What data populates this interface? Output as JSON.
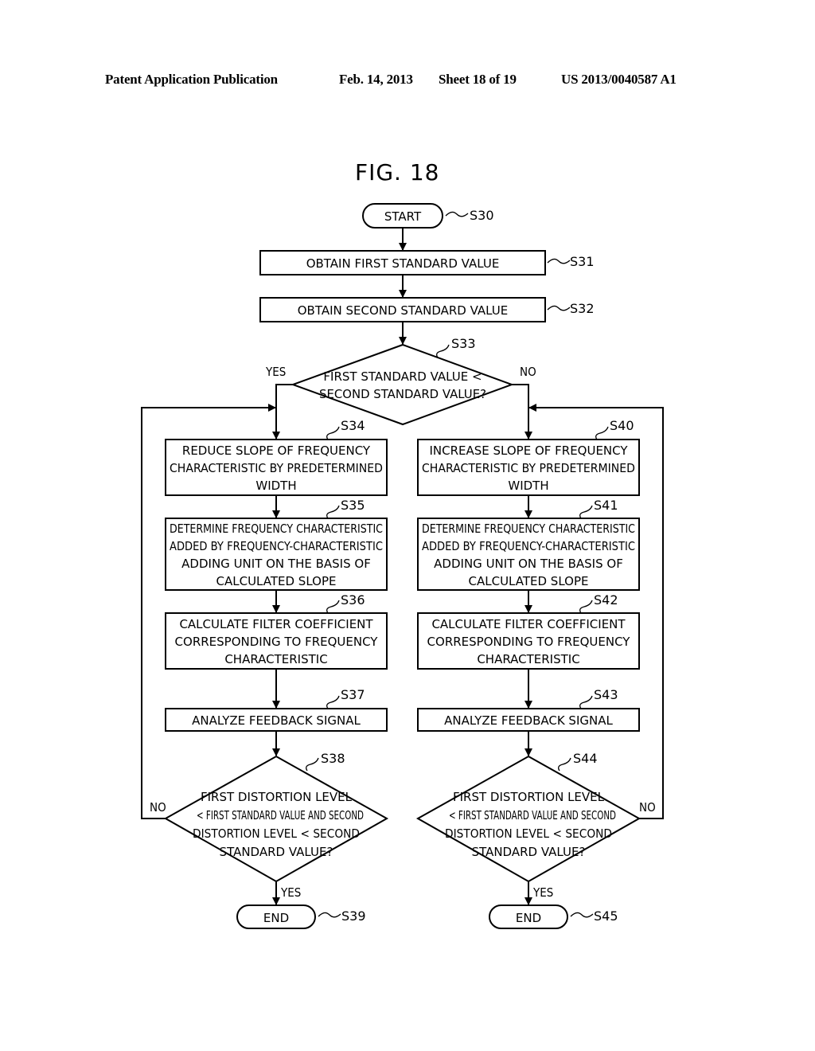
{
  "header": {
    "publication": "Patent Application Publication",
    "date": "Feb. 14, 2013",
    "sheet": "Sheet 18 of 19",
    "number": "US 2013/0040587 A1"
  },
  "figure": {
    "title": "FIG. 18"
  },
  "flowchart": {
    "start": {
      "id": "S30",
      "text": "START"
    },
    "s31": {
      "id": "S31",
      "lines": [
        "OBTAIN FIRST STANDARD VALUE"
      ]
    },
    "s32": {
      "id": "S32",
      "lines": [
        "OBTAIN SECOND STANDARD VALUE"
      ]
    },
    "s33": {
      "id": "S33",
      "lines": [
        "FIRST STANDARD VALUE <",
        "SECOND STANDARD VALUE?"
      ],
      "yes": "YES",
      "no": "NO"
    },
    "left": {
      "s34": {
        "id": "S34",
        "lines": [
          "REDUCE SLOPE OF FREQUENCY",
          "CHARACTERISTIC BY PREDETERMINED",
          "WIDTH"
        ]
      },
      "s35": {
        "id": "S35",
        "lines": [
          "DETERMINE FREQUENCY CHARACTERISTIC",
          "ADDED BY FREQUENCY-CHARACTERISTIC",
          "ADDING UNIT ON THE BASIS OF",
          "CALCULATED SLOPE"
        ]
      },
      "s36": {
        "id": "S36",
        "lines": [
          "CALCULATE FILTER COEFFICIENT",
          "CORRESPONDING TO FREQUENCY",
          "CHARACTERISTIC"
        ]
      },
      "s37": {
        "id": "S37",
        "lines": [
          "ANALYZE FEEDBACK SIGNAL"
        ]
      },
      "s38": {
        "id": "S38",
        "lines": [
          "FIRST DISTORTION LEVEL",
          "< FIRST STANDARD VALUE AND SECOND",
          "DISTORTION LEVEL < SECOND",
          "STANDARD VALUE?"
        ],
        "yes": "YES",
        "no": "NO"
      },
      "end": {
        "id": "S39",
        "text": "END"
      }
    },
    "right": {
      "s40": {
        "id": "S40",
        "lines": [
          "INCREASE SLOPE OF FREQUENCY",
          "CHARACTERISTIC BY PREDETERMINED",
          "WIDTH"
        ]
      },
      "s41": {
        "id": "S41",
        "lines": [
          "DETERMINE FREQUENCY CHARACTERISTIC",
          "ADDED BY FREQUENCY-CHARACTERISTIC",
          "ADDING UNIT ON THE BASIS OF",
          "CALCULATED SLOPE"
        ]
      },
      "s42": {
        "id": "S42",
        "lines": [
          "CALCULATE FILTER COEFFICIENT",
          "CORRESPONDING TO FREQUENCY",
          "CHARACTERISTIC"
        ]
      },
      "s43": {
        "id": "S43",
        "lines": [
          "ANALYZE FEEDBACK SIGNAL"
        ]
      },
      "s44": {
        "id": "S44",
        "lines": [
          "FIRST DISTORTION LEVEL",
          "< FIRST STANDARD VALUE AND SECOND",
          "DISTORTION LEVEL < SECOND",
          "STANDARD VALUE?"
        ],
        "yes": "YES",
        "no": "NO"
      },
      "end": {
        "id": "S45",
        "text": "END"
      }
    }
  }
}
